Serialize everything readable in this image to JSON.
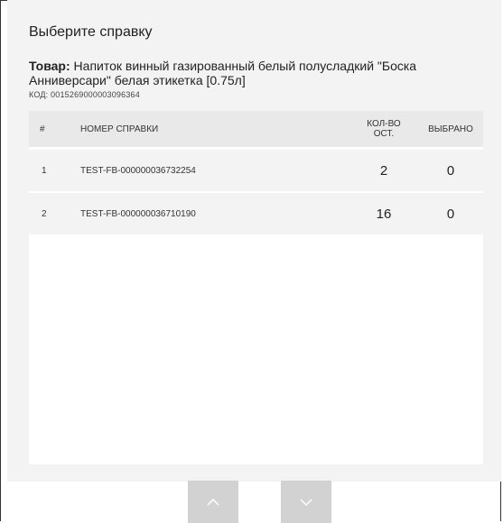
{
  "dialog": {
    "title": "Выберите справку",
    "product_label": "Товар:",
    "product_name": "Напиток винный газированный белый полусладкий \"Боска Анниверсари\" белая этикетка  [0.75л]",
    "code_text": "КОД: 0015269000003096364"
  },
  "table": {
    "headers": {
      "num": "#",
      "name": "НОМЕР СПРАВКИ",
      "qty_line1": "КОЛ-ВО",
      "qty_line2": "ОСТ.",
      "selected": "ВЫБРАНО"
    },
    "rows": [
      {
        "num": "1",
        "name": "TEST-FB-000000036732254",
        "qty": "2",
        "selected": "0"
      },
      {
        "num": "2",
        "name": "TEST-FB-000000036710190",
        "qty": "16",
        "selected": "0"
      }
    ]
  },
  "controls": {
    "up_icon": "chevron-up-icon",
    "down_icon": "chevron-down-icon"
  },
  "colors": {
    "panel_bg": "#f3f3f3",
    "header_bg": "#e9e9e9",
    "button_bg": "#d2d2d2",
    "table_bg": "#ffffff"
  }
}
